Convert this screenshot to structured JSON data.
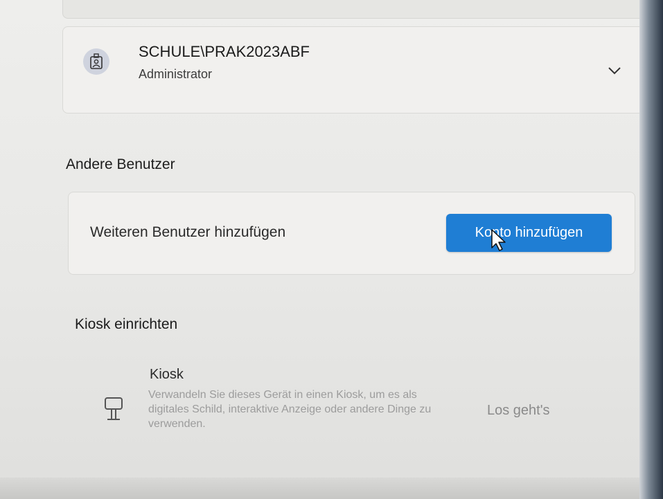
{
  "account": {
    "name": "SCHULE\\PRAK2023ABF",
    "role": "Administrator",
    "avatar_icon": "user-badge-icon",
    "expand_icon": "chevron-down-icon"
  },
  "other_users": {
    "section_title": "Andere Benutzer",
    "add_user_label": "Weiteren Benutzer hinzufügen",
    "add_account_button": "Konto hinzufügen"
  },
  "kiosk": {
    "section_title": "Kiosk einrichten",
    "icon": "kiosk-sign-icon",
    "title": "Kiosk",
    "description": "Verwandeln Sie dieses Gerät in einen Kiosk, um es als digitales Schild, interaktive Anzeige oder andere Dinge zu verwenden.",
    "action": "Los geht's"
  },
  "colors": {
    "accent": "#1f7ed4"
  }
}
